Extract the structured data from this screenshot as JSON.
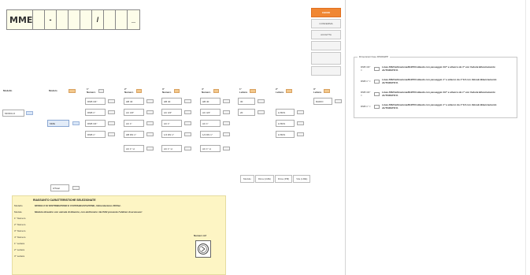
{
  "code": {
    "main": "MME",
    "cells": [
      "",
      "-",
      "",
      "",
      "",
      "/",
      "",
      "",
      "_"
    ]
  },
  "buttons": [
    "CHIUDI",
    "CONFERMA",
    "ACCETTA",
    "",
    "",
    ""
  ],
  "headers": {
    "modello": "Modello",
    "modulo": "Modulo",
    "numero1": "1° Numero",
    "numero2": "2° Numero",
    "numero3": "3° Numero",
    "numero4": "4° Numero",
    "lettera1": "1° Lettera",
    "lettera2": "2° Lettera",
    "lettera3": "3° Lettera"
  },
  "grid": {
    "modello": [
      "MODULO"
    ],
    "modulo": [
      "MME"
    ],
    "numero1": [
      "DNB 3/4\"",
      "DNB 1\"",
      "DNB 3/4\"",
      "DNB 1\""
    ],
    "numero2": [
      "HB 40",
      "AC 3/4\"",
      "AC 1\"",
      "HB DN 1\"",
      "AC 1\"",
      "AC 1\" H"
    ],
    "numero3": [
      "HB 40",
      "AC 3/4\"",
      "AC 1\"",
      "1/4 DN 1\"",
      "AC 1\" H"
    ],
    "numero4": [
      "HB 40",
      "AC 3/4\"",
      "AC 1\"",
      "1/4 DN 1\"",
      "AC 1\" H"
    ],
    "lettera1": [
      "30",
      "20"
    ],
    "lettera2": [
      "H BUS",
      "H BUS",
      "H BUS"
    ],
    "lettera3": [
      "RADIO"
    ]
  },
  "small_input": "0/Total",
  "tabs": [
    "Modulo",
    "Dima (LME)",
    "Dima (PM)",
    "Vite (LME)"
  ],
  "summary": {
    "title": "RIASSUNTO CARATTERISTICHE SELEZIONATE",
    "rows": [
      {
        "label": "Modello",
        "value": "MODULO DI DISTRIBUZIONE E CONTABILIZZAZIONE, Alimentazione 230Vac."
      },
      {
        "label": "Modulo",
        "value": "Modulo idraulico con valvola di bilancio, con elettronico rile PAN proveste l'utilizzo di accessori"
      },
      {
        "label": "1° Numero",
        "value": ""
      },
      {
        "label": "2° Numero",
        "value": ""
      },
      {
        "label": "3° Numero",
        "value": ""
      },
      {
        "label": "4° Numero",
        "value": ""
      },
      {
        "label": "1° Lettera",
        "value": ""
      },
      {
        "label": "2° Lettera",
        "value": ""
      },
      {
        "label": "3° Lettera",
        "value": ""
      }
    ],
    "numero_label": "Numero AZ"
  },
  "side_panel": {
    "legend": "Dimensioni linee RIS/RHPP",
    "rows": [
      {
        "dn": "DNB 3/4\" =",
        "desc": "Linee RIS/Calibrazione/RHPP/collaudo con passaggio 3/4\" e attacco da 3\" con Valvole Bilanciamento AUTOMATICO."
      },
      {
        "dn": "DNB 1\" =",
        "desc": "Linee RIS/Calibrazione/RHPP/collaudo con passaggio 1\" e attacco da 1\"1/4 con Valvole Bilanciamento AUTOMATICO."
      },
      {
        "dn": "DNB 3/4\" =",
        "desc": "Linee RIS/Calibrazione/RHPP/collaudo con passaggio 3/4\" e attacco da 1\" con Valvole Bilanciamento AUTOMATICO."
      },
      {
        "dn": "DNB 1\" =",
        "desc": "Linee RIS/Calibrazione/RHPP/collaudo con passaggio 1\" e attacco da 1\"1/4 con Valvole Bilanciamento AUTOMATICO."
      }
    ]
  }
}
